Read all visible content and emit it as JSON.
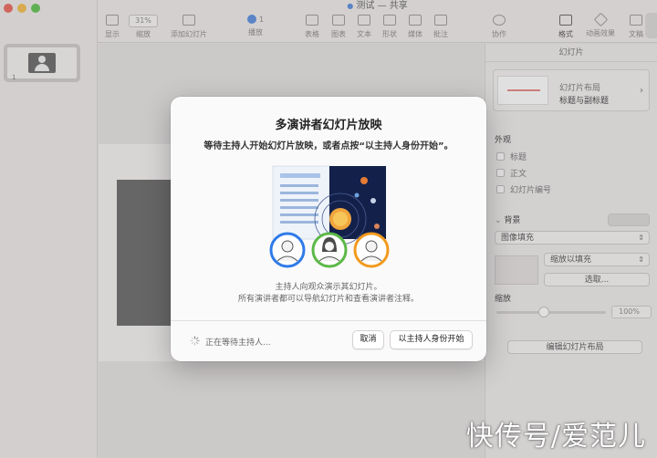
{
  "window": {
    "title": "测试",
    "separator": "—",
    "shared": "共享"
  },
  "toolbar": {
    "zoom_value": "31%",
    "slide_count": "1",
    "items": {
      "display": "显示",
      "zoom": "缩放",
      "add_slide": "添加幻灯片",
      "play": "播放",
      "table": "表格",
      "chart": "图表",
      "text": "文本",
      "shape": "形状",
      "media": "媒体",
      "comment": "批注",
      "collaborate": "协作",
      "format": "格式",
      "animate": "动画效果",
      "document": "文稿"
    }
  },
  "navigator": {
    "slide_number": "1"
  },
  "inspector": {
    "header": "幻灯片",
    "layout_label": "幻灯片布局",
    "layout_name": "标题与副标题",
    "appearance": "外观",
    "check_title": "标题",
    "check_body": "正文",
    "check_slide_number": "幻灯片编号",
    "background": "背景",
    "fill_type": "图像填充",
    "scale_mode": "缩放以填充",
    "choose": "选取...",
    "scale_label": "缩放",
    "scale_value": "100%",
    "edit_layout": "编辑幻灯片布局"
  },
  "dialog": {
    "title": "多演讲者幻灯片放映",
    "subtitle": "等待主持人开始幻灯片放映，或者点按“以主持人身份开始”。",
    "desc_line1": "主持人向观众演示其幻灯片。",
    "desc_line2": "所有演讲者都可以导航幻灯片和查看演讲者注释。",
    "waiting": "正在等待主持人...",
    "cancel": "取消",
    "start_as_host": "以主持人身份开始",
    "avatar_colors": [
      "#2f7be8",
      "#5cb848",
      "#f29a1e"
    ]
  },
  "watermark": "快传号/爱范儿"
}
